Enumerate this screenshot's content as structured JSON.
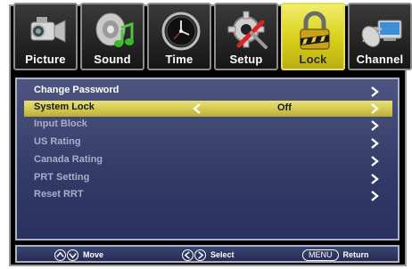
{
  "tabs": [
    {
      "label": "Picture",
      "icon": "camcorder-icon"
    },
    {
      "label": "Sound",
      "icon": "speaker-music-icon"
    },
    {
      "label": "Time",
      "icon": "clock-icon"
    },
    {
      "label": "Setup",
      "icon": "tools-icon"
    },
    {
      "label": "Lock",
      "icon": "padlock-icon",
      "active": true
    },
    {
      "label": "Channel",
      "icon": "satellite-dish-icon"
    }
  ],
  "menu": {
    "items": [
      {
        "label": "Change Password"
      },
      {
        "label": "System Lock",
        "value": "Off",
        "selected": true
      },
      {
        "label": "Input Block"
      },
      {
        "label": "US Rating"
      },
      {
        "label": "Canada Rating"
      },
      {
        "label": "PRT Setting"
      },
      {
        "label": "Reset RRT"
      }
    ]
  },
  "footer": {
    "move_label": "Move",
    "select_label": "Select",
    "menu_key": "MENU",
    "return_label": "Return"
  },
  "colors": {
    "panel": "#323a66",
    "highlight": "#d0c54c",
    "active_tab": "#d7cf1a"
  }
}
